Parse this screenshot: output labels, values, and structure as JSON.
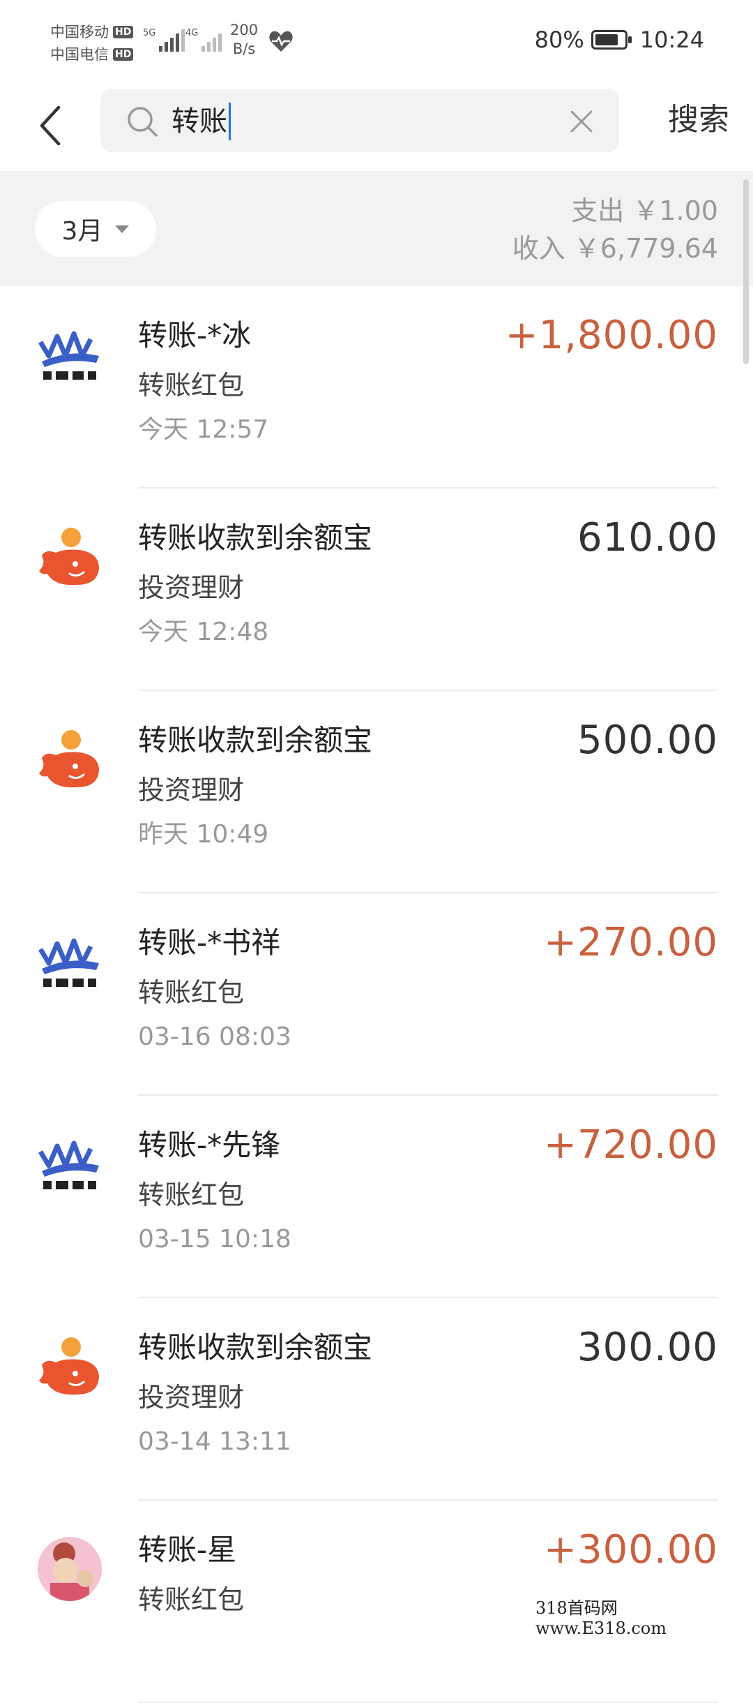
{
  "status_bar": {
    "carrier1": "中国移动",
    "carrier2": "中国电信",
    "hd_badge": "HD",
    "sig1_label": "5G",
    "sig2_label": "4G",
    "net_speed_value": "200",
    "net_speed_unit": "B/s",
    "battery_text": "80%",
    "battery_level": 0.8,
    "time": "10:24"
  },
  "search": {
    "query": "转账",
    "submit_label": "搜索"
  },
  "summary": {
    "month": "3月",
    "expense": "支出 ￥1.00",
    "income": "收入 ￥6,779.64"
  },
  "transactions": [
    {
      "icon": "blue-logo-icon",
      "title": "转账-*冰",
      "subtitle": "转账红包",
      "time": "今天  12:57",
      "amount": "+1,800.00",
      "kind": "in"
    },
    {
      "icon": "yuebao-icon",
      "title": "转账收款到余额宝",
      "subtitle": "投资理财",
      "time": "今天  12:48",
      "amount": "610.00",
      "kind": "neutral"
    },
    {
      "icon": "yuebao-icon",
      "title": "转账收款到余额宝",
      "subtitle": "投资理财",
      "time": "昨天  10:49",
      "amount": "500.00",
      "kind": "neutral"
    },
    {
      "icon": "blue-logo-icon",
      "title": "转账-*书祥",
      "subtitle": "转账红包",
      "time": "03-16  08:03",
      "amount": "+270.00",
      "kind": "in"
    },
    {
      "icon": "blue-logo-icon",
      "title": "转账-*先锋",
      "subtitle": "转账红包",
      "time": "03-15  10:18",
      "amount": "+720.00",
      "kind": "in"
    },
    {
      "icon": "yuebao-icon",
      "title": "转账收款到余额宝",
      "subtitle": "投资理财",
      "time": "03-14  13:11",
      "amount": "300.00",
      "kind": "neutral"
    },
    {
      "icon": "photo-avatar-icon",
      "title": "转账-星",
      "subtitle": "转账红包",
      "time": "",
      "amount": "+300.00",
      "kind": "in"
    }
  ],
  "watermark": "318首码网  www.E318.com",
  "colors": {
    "income_amount": "#c9603e",
    "neutral_amount": "#333333",
    "logo_blue": "#3a5fc8",
    "yuebao_orange": "#e9552f",
    "caret_blue": "#1a73e8"
  }
}
